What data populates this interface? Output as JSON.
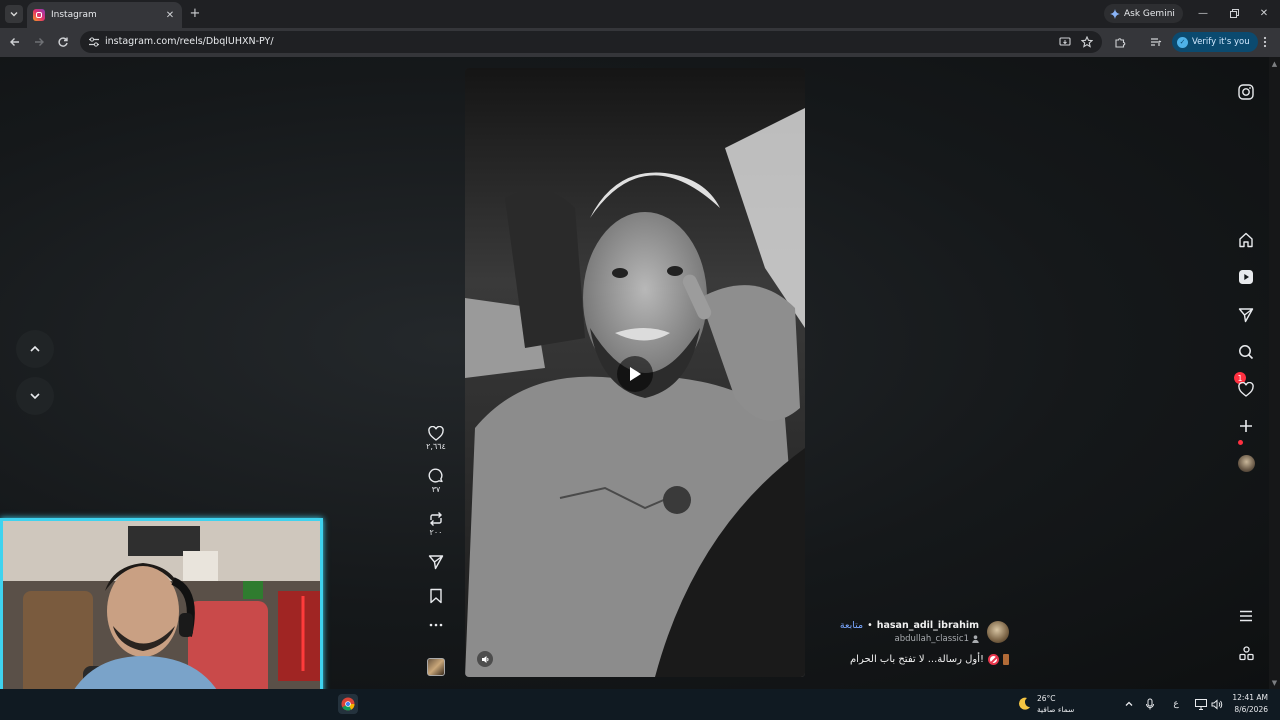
{
  "browser": {
    "tab_title": "Instagram",
    "ask_gemini_label": "Ask Gemini",
    "url": "instagram.com/reels/DbqlUHXN-PY/",
    "verify_label": "Verify it's you"
  },
  "reel_actions": {
    "likes": "٢,٦٦٤",
    "comments": "٣٧",
    "reposts": "٢٠٠"
  },
  "reel_meta": {
    "username": "hasan_adil_ibrahim",
    "separator": "•",
    "follow_label": "متابعة",
    "collaborator": "abdullah_classic1",
    "caption": "أول رسالة... لا تفتح باب الحرام!"
  },
  "sidebar": {
    "messages_badge": "1"
  },
  "taskbar": {
    "temperature": "26°C",
    "weather": "سماء صافية",
    "time": "12:41 AM",
    "date": "8/6/2026",
    "input_lang": "ع"
  },
  "colors": {
    "accent_link": "#7aa7ff",
    "badge": "#ff3040",
    "webcam_border": "#3fd3ef"
  }
}
